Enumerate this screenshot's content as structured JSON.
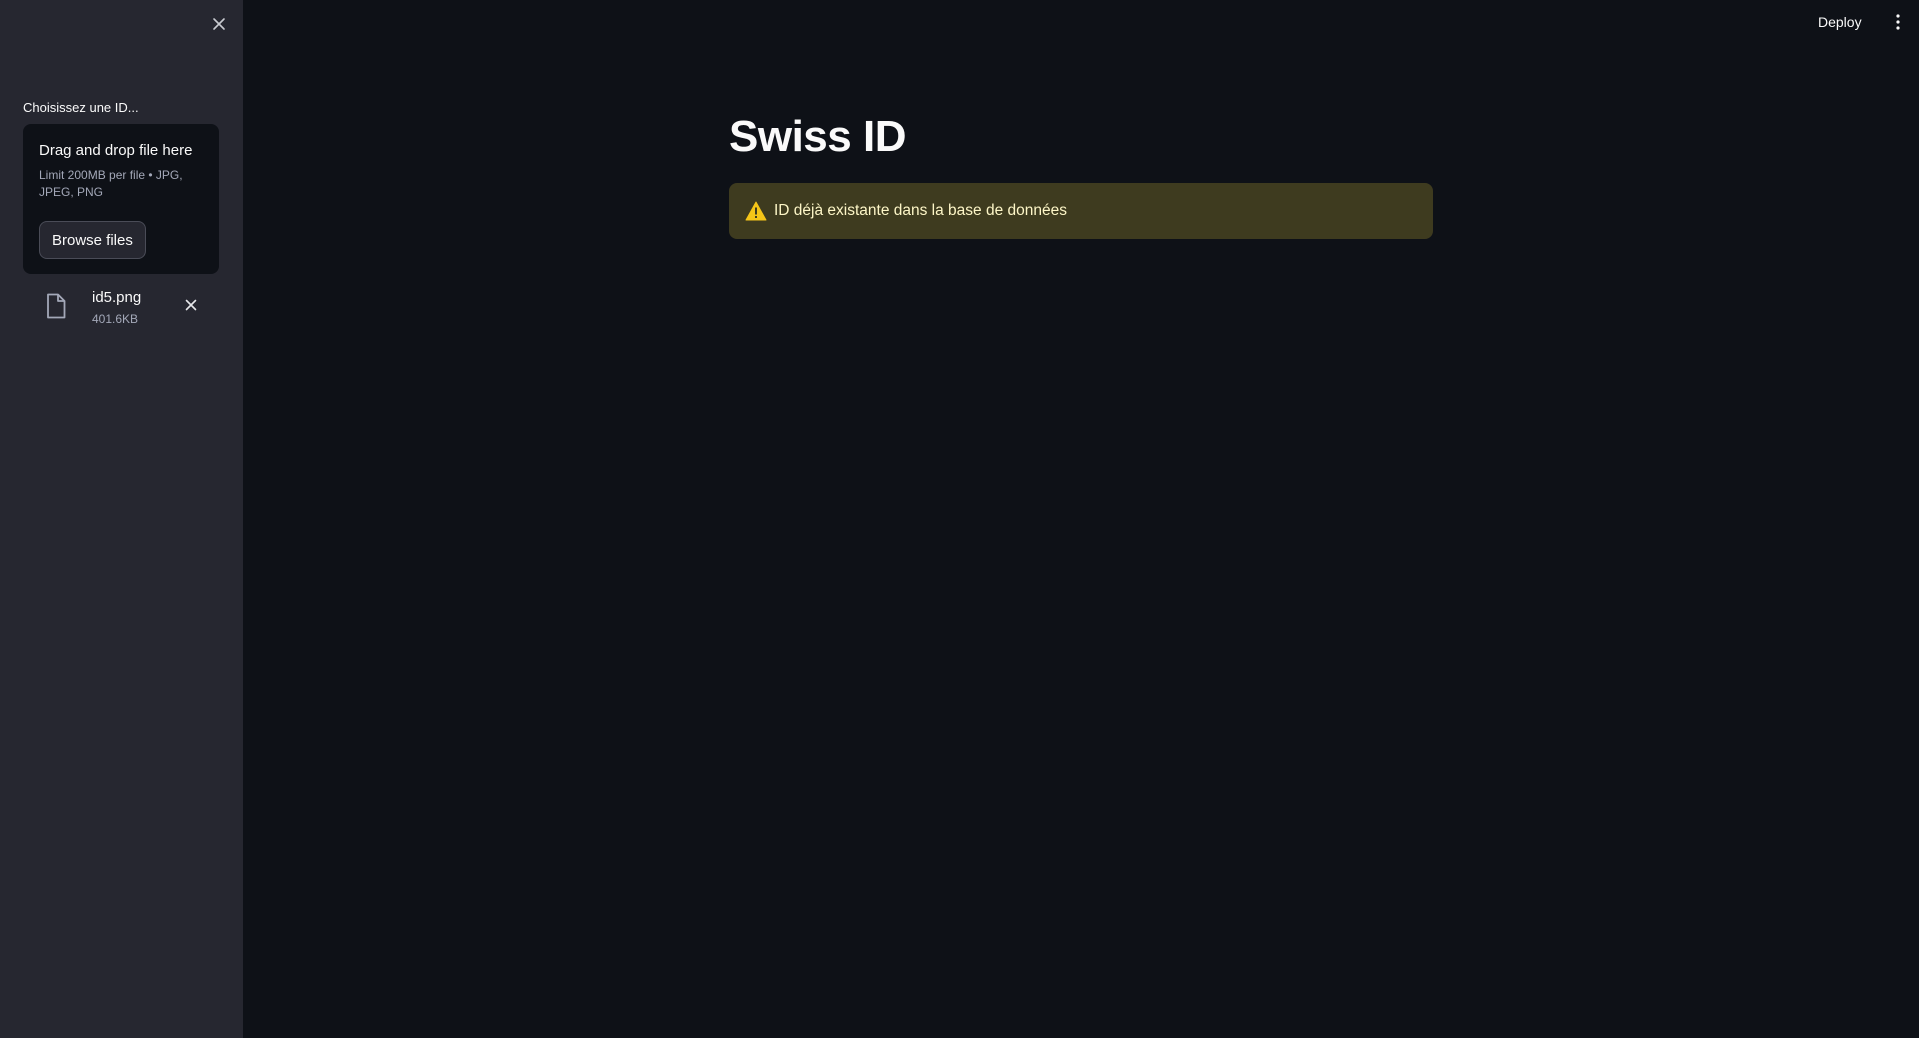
{
  "sidebar": {
    "uploader": {
      "label": "Choisissez une ID...",
      "dropzone_title": "Drag and drop file here",
      "dropzone_limit": "Limit 200MB per file • JPG, JPEG, PNG",
      "browse_label": "Browse files"
    },
    "file": {
      "name": "id5.png",
      "size": "401.6KB",
      "icon": "file-icon"
    }
  },
  "header": {
    "deploy_label": "Deploy"
  },
  "main": {
    "title": "Swiss ID",
    "alert": {
      "type": "warning",
      "icon": "warning-icon",
      "text": "ID déjà existante dans la base de données"
    }
  },
  "colors": {
    "background": "#0e1117",
    "sidebar": "#262730",
    "warning_bg": "#3e3b1f",
    "warning_text": "#fdf6c7",
    "warning_icon": "#f5c518"
  }
}
